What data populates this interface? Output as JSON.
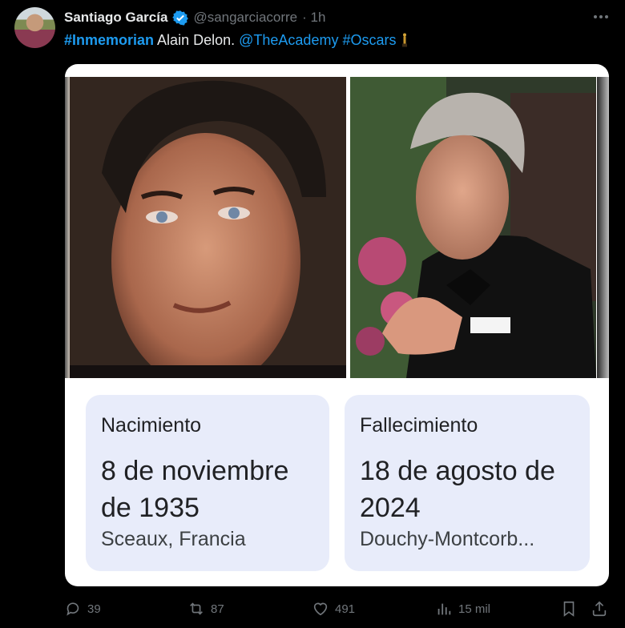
{
  "tweet": {
    "author_name": "Santiago García",
    "handle": "@sangarciacorre",
    "time": "· 1h",
    "text": {
      "hashtag1": "#Inmemorian",
      "plain": " Alain Delon. ",
      "mention": "@TheAcademy",
      "hashtag2": "#Oscars"
    }
  },
  "card": {
    "birth": {
      "label": "Nacimiento",
      "date": "8 de noviembre de 1935",
      "place": "Sceaux, Francia"
    },
    "death": {
      "label": "Fallecimiento",
      "date": "18 de agosto de 2024",
      "place": "Douchy-Montcorb..."
    }
  },
  "actions": {
    "replies": "39",
    "reposts": "87",
    "likes": "491",
    "views": "15 mil"
  },
  "colors": {
    "background": "#000000",
    "link": "#1d9bf0",
    "muted": "#71767b",
    "info_box": "#e8ecfa"
  }
}
